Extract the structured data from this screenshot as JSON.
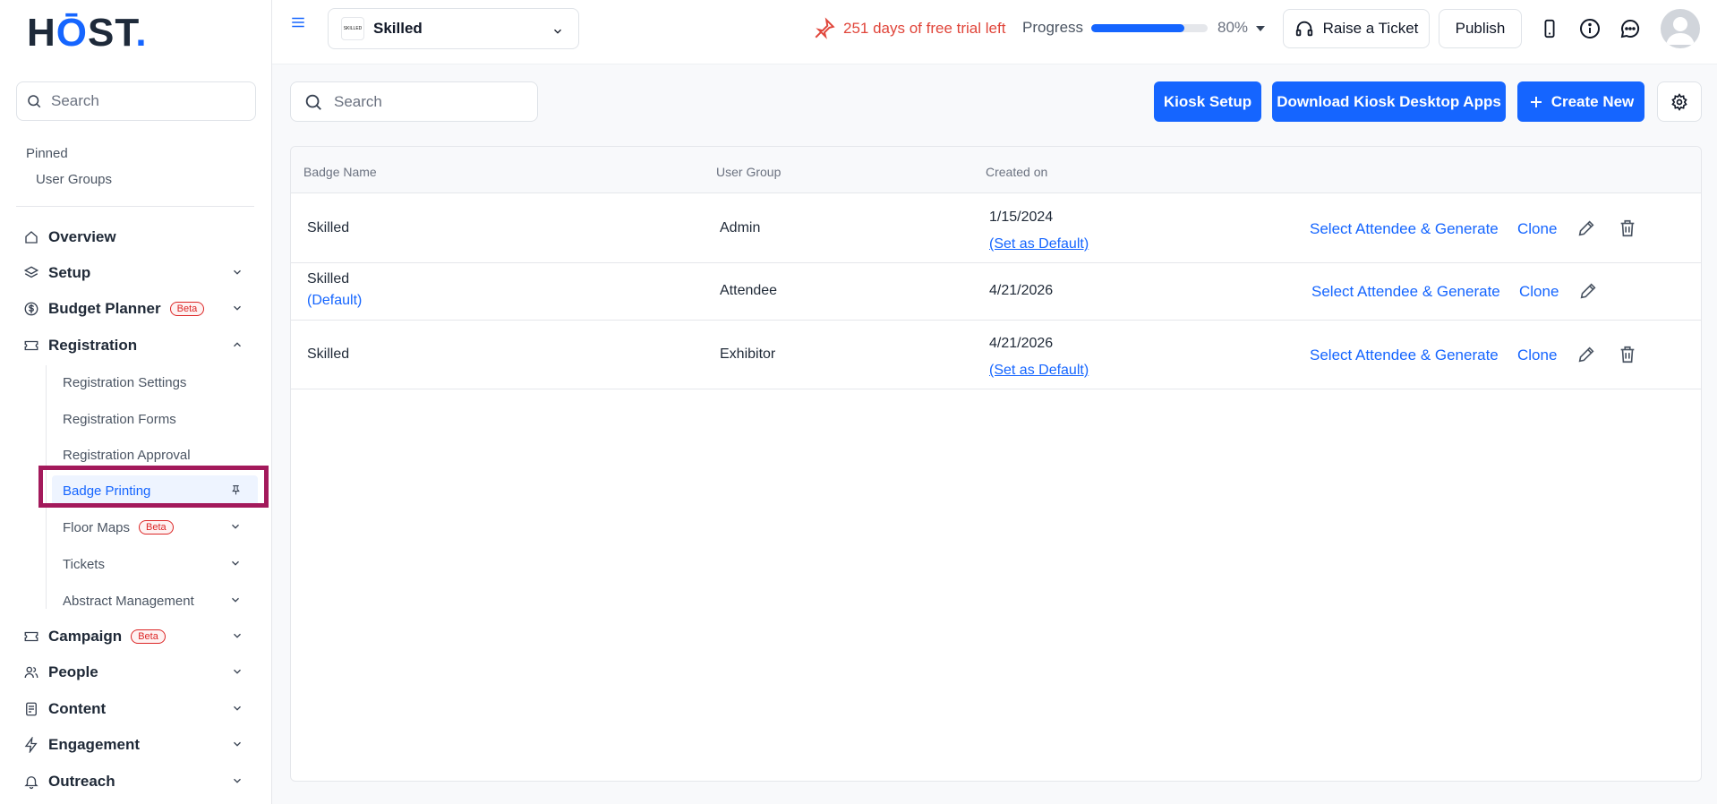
{
  "brand": {
    "logo_h": "H",
    "logo_o": "Ō",
    "logo_st": "ST",
    "logo_dot": "."
  },
  "sidebar": {
    "search_placeholder": "Search",
    "pinned_title": "Pinned",
    "pinned_items": [
      "User Groups"
    ],
    "nav": [
      {
        "label": "Overview",
        "icon": "home-icon"
      },
      {
        "label": "Setup",
        "icon": "layers-icon"
      },
      {
        "label": "Budget Planner",
        "icon": "dollar-icon",
        "badge": "Beta"
      },
      {
        "label": "Registration",
        "icon": "ticket-icon"
      },
      {
        "label": "Campaign",
        "icon": "ticket-icon",
        "badge": "Beta"
      },
      {
        "label": "People",
        "icon": "people-icon"
      },
      {
        "label": "Content",
        "icon": "document-icon"
      },
      {
        "label": "Engagement",
        "icon": "bolt-icon"
      },
      {
        "label": "Outreach",
        "icon": "bell-icon"
      }
    ],
    "registration_sub": [
      {
        "label": "Registration Settings"
      },
      {
        "label": "Registration Forms"
      },
      {
        "label": "Registration Approval"
      },
      {
        "label": "Badge Printing",
        "active": true
      },
      {
        "label": "Floor Maps",
        "badge": "Beta"
      },
      {
        "label": "Tickets"
      },
      {
        "label": "Abstract Management"
      }
    ]
  },
  "topbar": {
    "event_name": "Skilled",
    "event_thumb_text": "SKILLED",
    "trial_text": "251 days of free trial left",
    "progress_label": "Progress",
    "progress_value": 80,
    "progress_text": "80%",
    "raise_ticket": "Raise a Ticket",
    "publish": "Publish"
  },
  "toolbar": {
    "search_placeholder": "Search",
    "kiosk_setup": "Kiosk Setup",
    "download_kiosk": "Download Kiosk Desktop Apps",
    "create_new": "Create New"
  },
  "table": {
    "headers": [
      "Badge Name",
      "User Group",
      "Created on"
    ],
    "rows": [
      {
        "badge": "Skilled",
        "badge_default": "",
        "group": "Admin",
        "created": "1/15/2024",
        "set_default": "(Set as Default)",
        "generate": "Select Attendee & Generate",
        "clone": "Clone",
        "deletable": true
      },
      {
        "badge": "Skilled",
        "badge_default": "(Default)",
        "group": "Attendee",
        "created": "4/21/2026",
        "set_default": "",
        "generate": "Select Attendee & Generate",
        "clone": "Clone",
        "deletable": false
      },
      {
        "badge": "Skilled",
        "badge_default": "",
        "group": "Exhibitor",
        "created": "4/21/2026",
        "set_default": "(Set as Default)",
        "generate": "Select Attendee & Generate",
        "clone": "Clone",
        "deletable": true
      }
    ]
  },
  "colors": {
    "accent": "#1565ff",
    "trial": "#e0453a",
    "highlight": "#a3195b"
  }
}
